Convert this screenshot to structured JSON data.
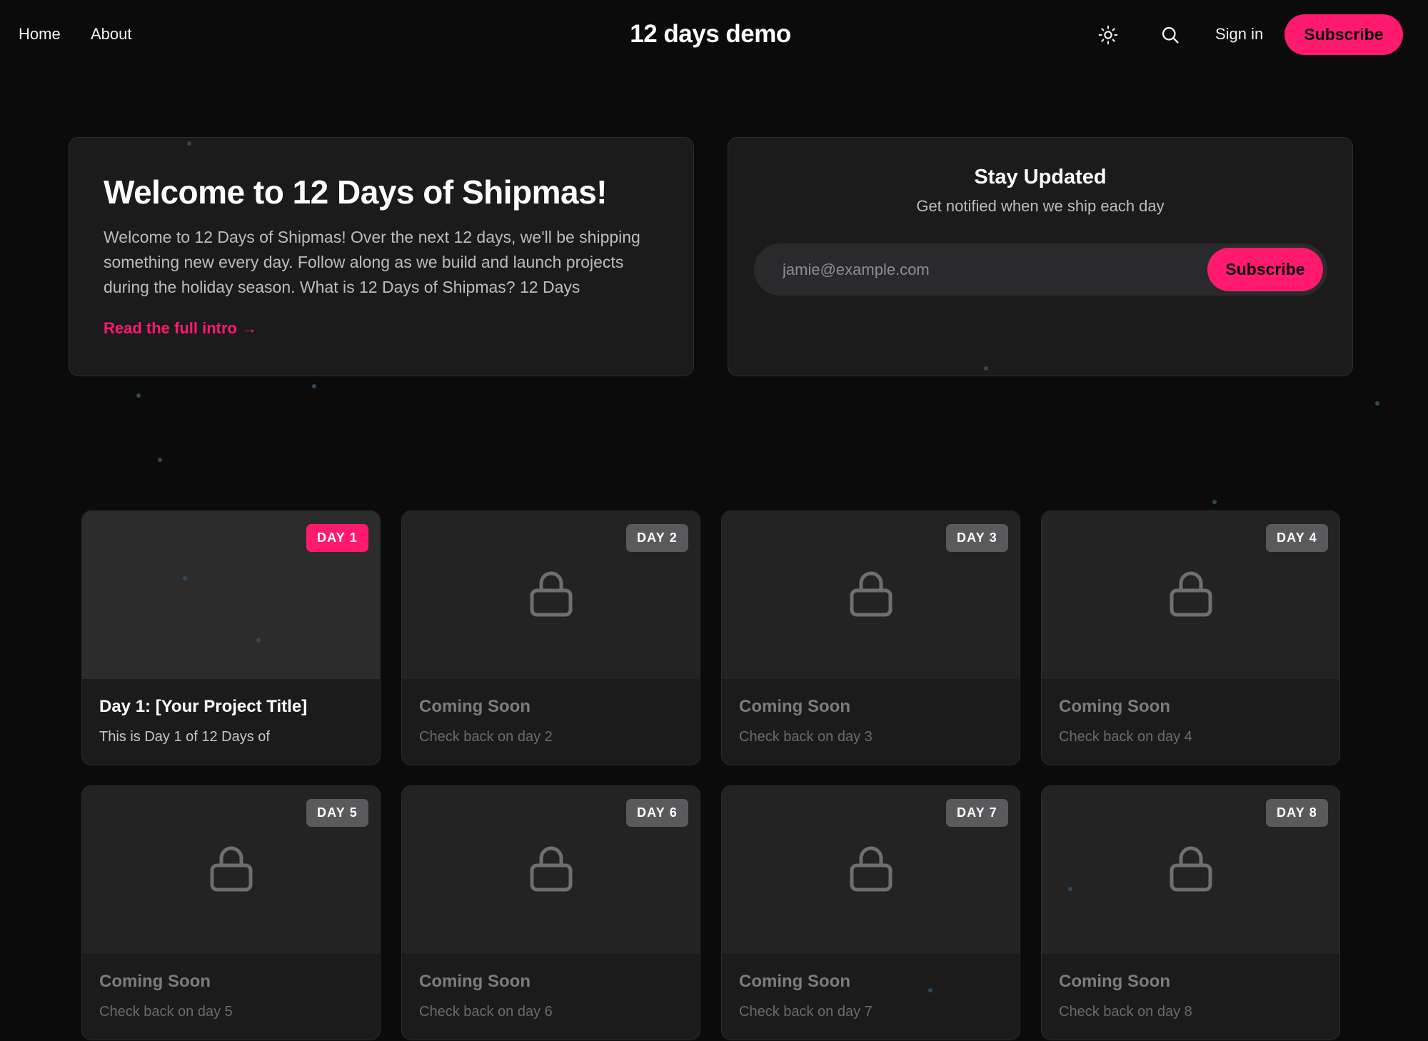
{
  "nav": {
    "home": "Home",
    "about": "About",
    "site_title": "12 days demo",
    "theme_icon": "sun-icon",
    "search_icon": "search-icon",
    "sign_in": "Sign in",
    "subscribe": "Subscribe"
  },
  "welcome": {
    "title": "Welcome to 12 Days of Shipmas!",
    "body": "Welcome to 12 Days of Shipmas! Over the next 12 days, we'll be shipping something new every day. Follow along as we build and launch projects during the holiday season. What is 12 Days of Shipmas? 12 Days",
    "read_more": "Read the full intro →"
  },
  "updates": {
    "title": "Stay Updated",
    "subtitle": "Get notified when we ship each day",
    "email_placeholder": "jamie@example.com",
    "submit": "Subscribe"
  },
  "days": [
    {
      "badge": "DAY 1",
      "title": "Day 1: [Your Project Title]",
      "desc": "This is Day 1 of 12 Days of",
      "locked": false
    },
    {
      "badge": "DAY 2",
      "title": "Coming Soon",
      "desc": "Check back on day 2",
      "locked": true
    },
    {
      "badge": "DAY 3",
      "title": "Coming Soon",
      "desc": "Check back on day 3",
      "locked": true
    },
    {
      "badge": "DAY 4",
      "title": "Coming Soon",
      "desc": "Check back on day 4",
      "locked": true
    },
    {
      "badge": "DAY 5",
      "title": "Coming Soon",
      "desc": "Check back on day 5",
      "locked": true
    },
    {
      "badge": "DAY 6",
      "title": "Coming Soon",
      "desc": "Check back on day 6",
      "locked": true
    },
    {
      "badge": "DAY 7",
      "title": "Coming Soon",
      "desc": "Check back on day 7",
      "locked": true
    },
    {
      "badge": "DAY 8",
      "title": "Coming Soon",
      "desc": "Check back on day 8",
      "locked": true
    }
  ],
  "colors": {
    "accent": "#ff1a6e",
    "background": "#0b0b0c",
    "card": "#1b1b1c",
    "locked_badge": "#5a5a5c"
  }
}
